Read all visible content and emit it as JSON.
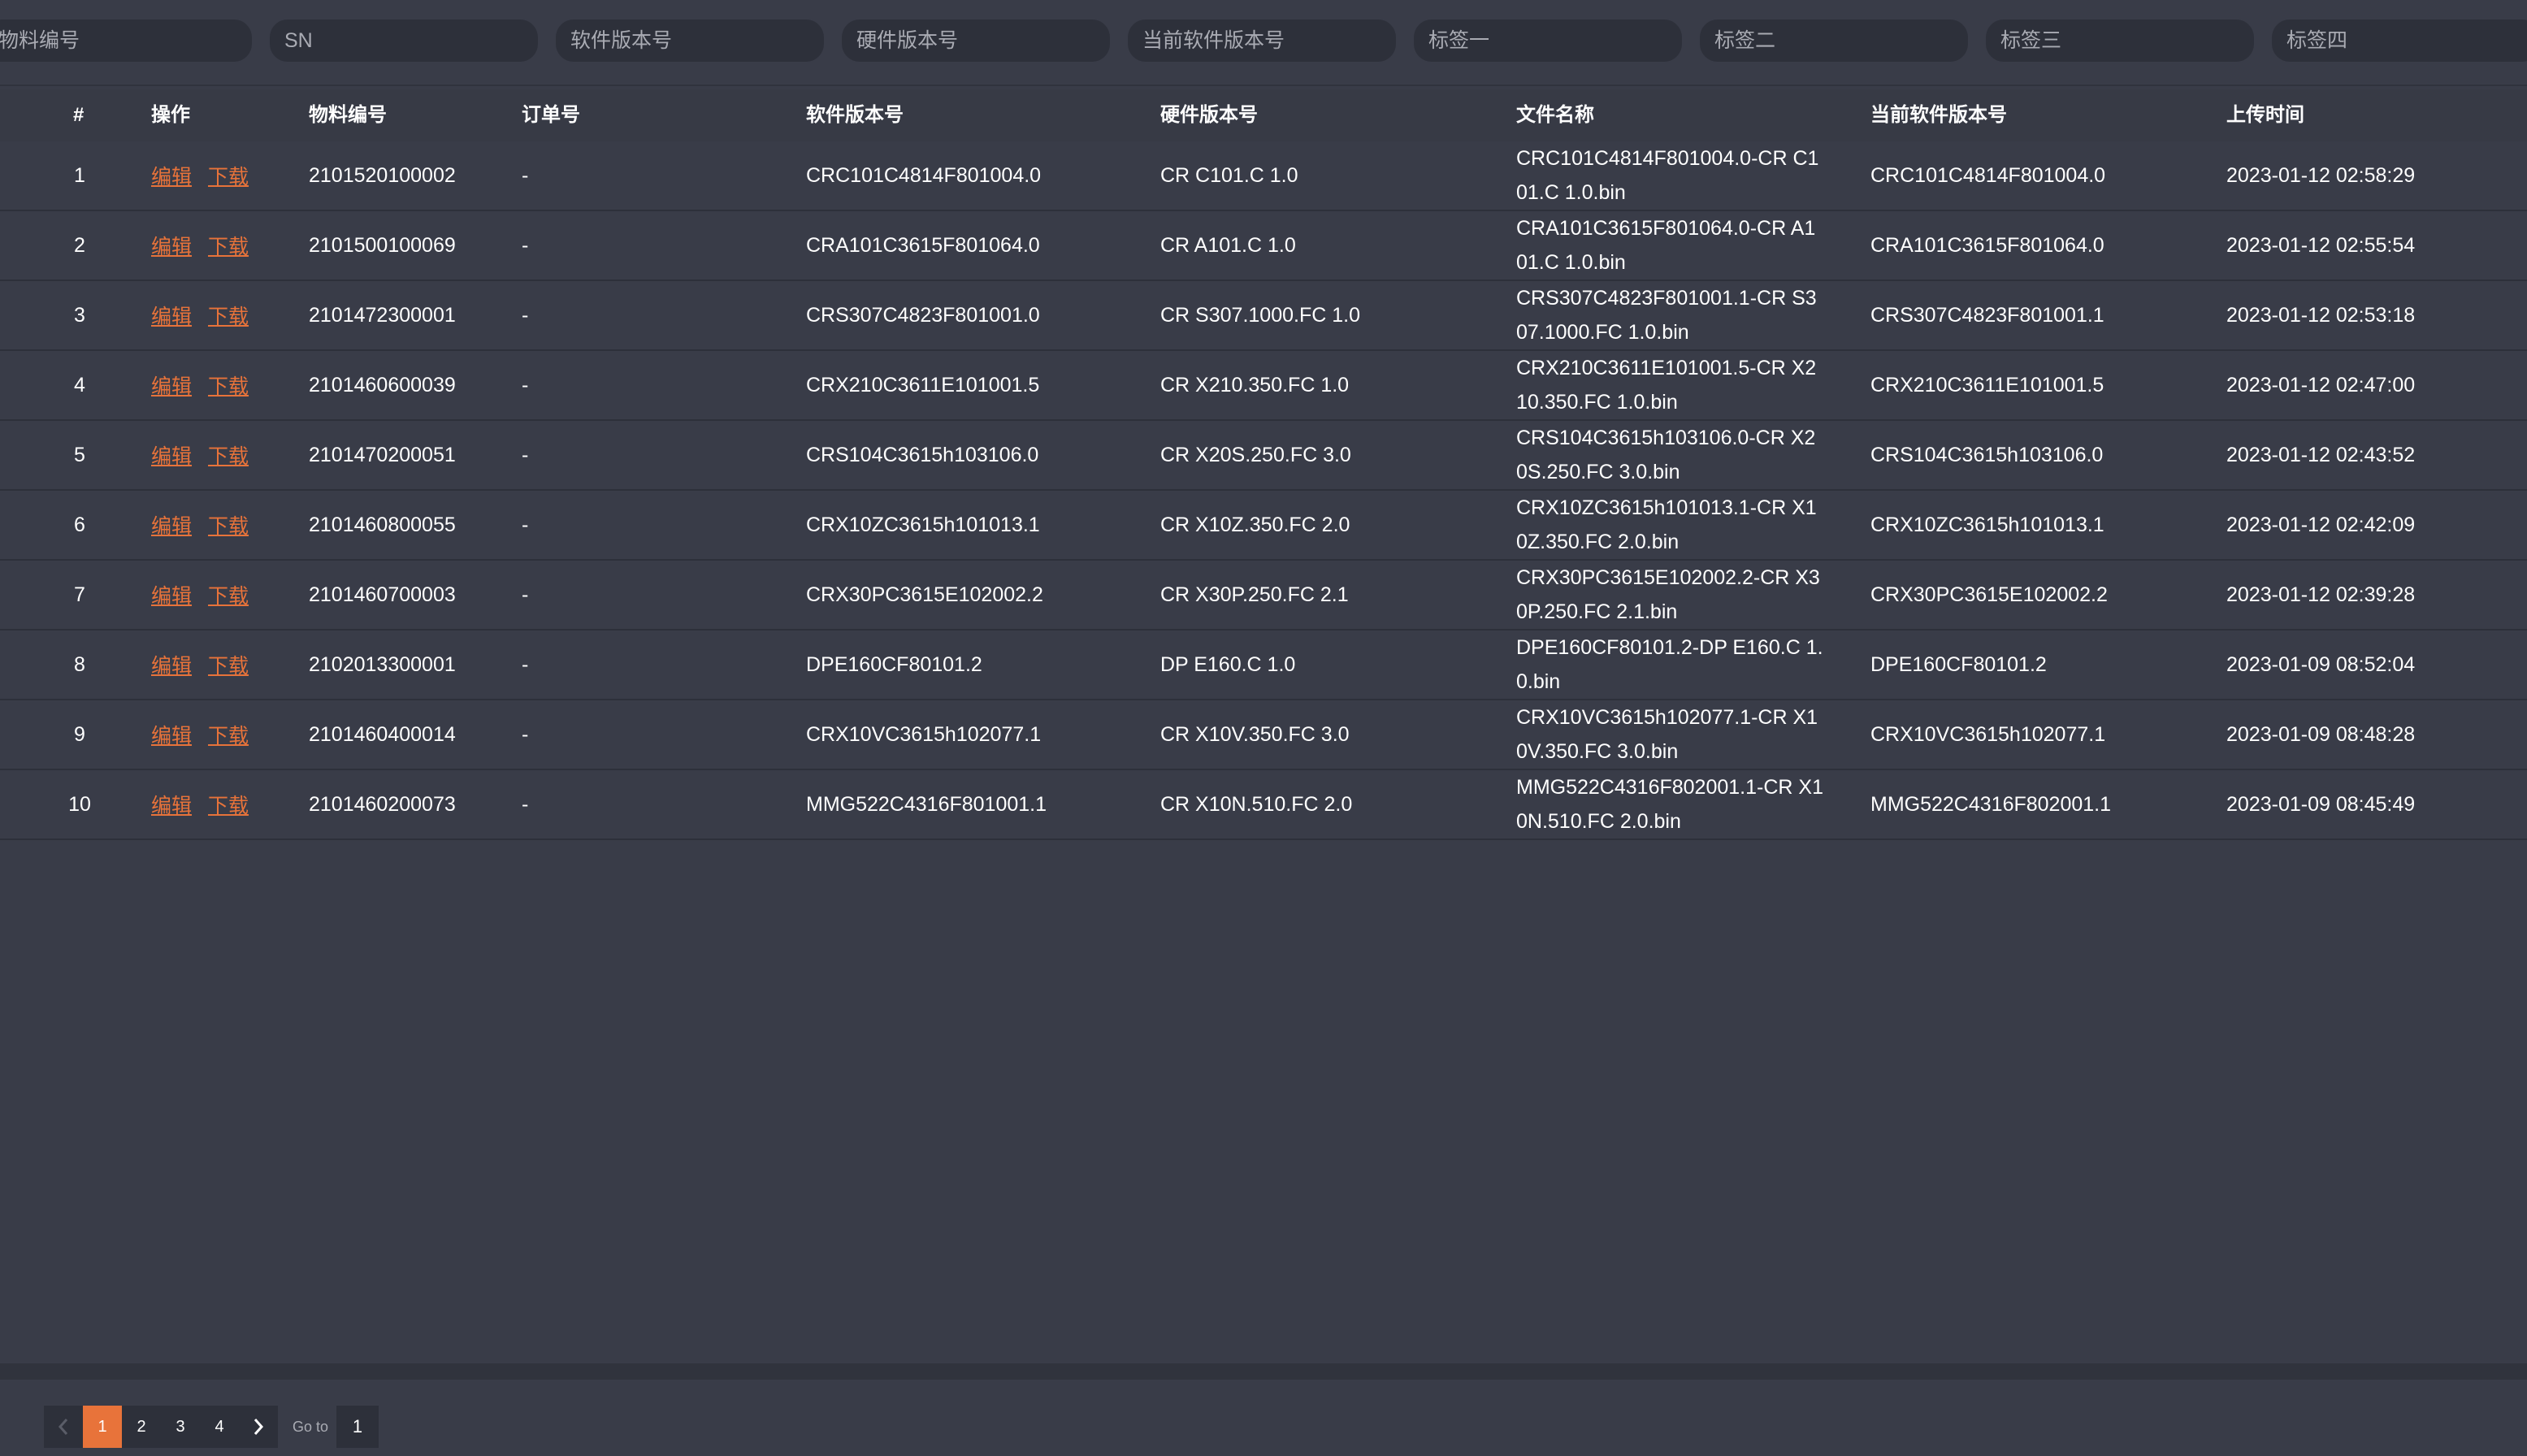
{
  "filters": [
    {
      "placeholder": "物料编号"
    },
    {
      "placeholder": "SN"
    },
    {
      "placeholder": "软件版本号"
    },
    {
      "placeholder": "硬件版本号"
    },
    {
      "placeholder": "当前软件版本号"
    },
    {
      "placeholder": "标签一"
    },
    {
      "placeholder": "标签二"
    },
    {
      "placeholder": "标签三"
    },
    {
      "placeholder": "标签四"
    }
  ],
  "table": {
    "headers": {
      "index": "#",
      "operation": "操作",
      "material_no": "物料编号",
      "order_no": "订单号",
      "software_version": "软件版本号",
      "hardware_version": "硬件版本号",
      "file_name": "文件名称",
      "current_software_version": "当前软件版本号",
      "upload_time": "上传时间"
    },
    "edit_label": "编辑",
    "download_label": "下载",
    "rows": [
      {
        "index": "1",
        "material_no": "2101520100002",
        "order_no": "-",
        "software_version": "CRC101C4814F801004.0",
        "hardware_version": "CR C101.C 1.0",
        "file_name": "CRC101C4814F801004.0-CR C101.C 1.0.bin",
        "current_software_version": "CRC101C4814F801004.0",
        "upload_time": "2023-01-12 02:58:29"
      },
      {
        "index": "2",
        "material_no": "2101500100069",
        "order_no": "-",
        "software_version": "CRA101C3615F801064.0",
        "hardware_version": "CR A101.C 1.0",
        "file_name": "CRA101C3615F801064.0-CR A101.C 1.0.bin",
        "current_software_version": "CRA101C3615F801064.0",
        "upload_time": "2023-01-12 02:55:54"
      },
      {
        "index": "3",
        "material_no": "2101472300001",
        "order_no": "-",
        "software_version": "CRS307C4823F801001.0",
        "hardware_version": "CR S307.1000.FC 1.0",
        "file_name": "CRS307C4823F801001.1-CR S307.1000.FC 1.0.bin",
        "current_software_version": "CRS307C4823F801001.1",
        "upload_time": "2023-01-12 02:53:18"
      },
      {
        "index": "4",
        "material_no": "2101460600039",
        "order_no": "-",
        "software_version": "CRX210C3611E101001.5",
        "hardware_version": "CR X210.350.FC 1.0",
        "file_name": "CRX210C3611E101001.5-CR X210.350.FC 1.0.bin",
        "current_software_version": "CRX210C3611E101001.5",
        "upload_time": "2023-01-12 02:47:00"
      },
      {
        "index": "5",
        "material_no": "2101470200051",
        "order_no": "-",
        "software_version": "CRS104C3615h103106.0",
        "hardware_version": "CR X20S.250.FC 3.0",
        "file_name": "CRS104C3615h103106.0-CR X20S.250.FC 3.0.bin",
        "current_software_version": "CRS104C3615h103106.0",
        "upload_time": "2023-01-12 02:43:52"
      },
      {
        "index": "6",
        "material_no": "2101460800055",
        "order_no": "-",
        "software_version": "CRX10ZC3615h101013.1",
        "hardware_version": "CR X10Z.350.FC 2.0",
        "file_name": "CRX10ZC3615h101013.1-CR X10Z.350.FC 2.0.bin",
        "current_software_version": "CRX10ZC3615h101013.1",
        "upload_time": "2023-01-12 02:42:09"
      },
      {
        "index": "7",
        "material_no": "2101460700003",
        "order_no": "-",
        "software_version": "CRX30PC3615E102002.2",
        "hardware_version": "CR X30P.250.FC 2.1",
        "file_name": "CRX30PC3615E102002.2-CR X30P.250.FC 2.1.bin",
        "current_software_version": "CRX30PC3615E102002.2",
        "upload_time": "2023-01-12 02:39:28"
      },
      {
        "index": "8",
        "material_no": "2102013300001",
        "order_no": "-",
        "software_version": "DPE160CF80101.2",
        "hardware_version": "DP E160.C 1.0",
        "file_name": "DPE160CF80101.2-DP E160.C 1.0.bin",
        "current_software_version": "DPE160CF80101.2",
        "upload_time": "2023-01-09 08:52:04"
      },
      {
        "index": "9",
        "material_no": "2101460400014",
        "order_no": "-",
        "software_version": "CRX10VC3615h102077.1",
        "hardware_version": "CR X10V.350.FC 3.0",
        "file_name": "CRX10VC3615h102077.1-CR X10V.350.FC 3.0.bin",
        "current_software_version": "CRX10VC3615h102077.1",
        "upload_time": "2023-01-09 08:48:28"
      },
      {
        "index": "10",
        "material_no": "2101460200073",
        "order_no": "-",
        "software_version": "MMG522C4316F801001.1",
        "hardware_version": "CR X10N.510.FC 2.0",
        "file_name": "MMG522C4316F802001.1-CR X10N.510.FC 2.0.bin",
        "current_software_version": "MMG522C4316F802001.1",
        "upload_time": "2023-01-09 08:45:49"
      }
    ]
  },
  "pagination": {
    "pages": [
      "1",
      "2",
      "3",
      "4"
    ],
    "current_page": "1",
    "goto_label": "Go to",
    "goto_value": "1",
    "prev_icon": "chevron-left-icon",
    "next_icon": "chevron-right-icon"
  },
  "colors": {
    "background": "#393c48",
    "input_background": "#2d303a",
    "accent": "#e8733a"
  }
}
